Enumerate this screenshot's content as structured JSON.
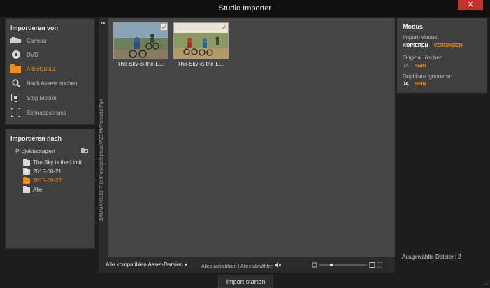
{
  "window": {
    "title": "Studio Importer",
    "close": "✕"
  },
  "import_from": {
    "heading": "Importieren von",
    "items": [
      {
        "label": "Camera"
      },
      {
        "label": "DVD"
      },
      {
        "label": "Arbeitsplatz"
      },
      {
        "label": "Nach Assets suchen"
      },
      {
        "label": "Stop Motion"
      },
      {
        "label": "Schnappschuss"
      }
    ]
  },
  "import_to": {
    "heading": "Importieren nach",
    "section": "Projektablagen",
    "folders": [
      {
        "label": "The Sky is the Limit"
      },
      {
        "label": "2015-08-21"
      },
      {
        "label": "2015-09-22"
      },
      {
        "label": "Alle"
      }
    ]
  },
  "path": "BAUMANSICHT D:\\Projects\\tlphus\\WZDM\\Pinnacle\\Pgit",
  "thumbnails": [
    {
      "caption": "The-Sky-is-the-Li..."
    },
    {
      "caption": "The-Sky-is-the-Li..."
    }
  ],
  "bottombar": {
    "filter": "Alle kompatiblen Asset-Dateien",
    "select_all": "Alles auswählen",
    "separator": "|",
    "deselect_all": "Alles abwählen"
  },
  "import_button": "Import starten",
  "mode": {
    "heading": "Modus",
    "import_mode_label": "Import-Modus",
    "import_mode_copy": "KOPIEREN",
    "import_mode_link": "VERBINDEN",
    "delete_original_label": "Original löschen",
    "delete_yes": "JA",
    "delete_no": "NEIN",
    "ignore_duplicates_label": "Duplikate ignorieren",
    "dup_yes": "JA",
    "dup_no": "NEIN"
  },
  "status": {
    "selected_files": "Ausgewählte Dateien: 2"
  },
  "colors": {
    "accent": "#f28c16",
    "close": "#c9302c"
  }
}
